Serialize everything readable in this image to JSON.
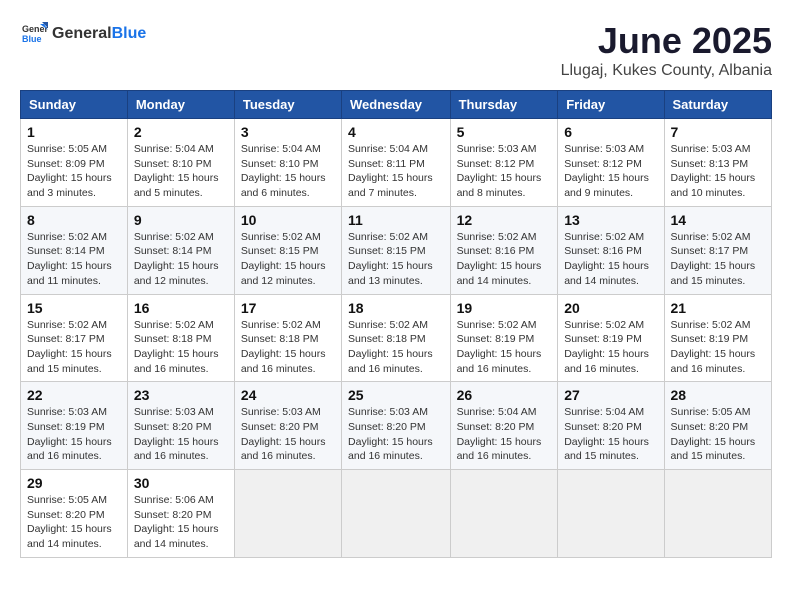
{
  "logo": {
    "general": "General",
    "blue": "Blue"
  },
  "header": {
    "month_year": "June 2025",
    "location": "Llugaj, Kukes County, Albania"
  },
  "weekdays": [
    "Sunday",
    "Monday",
    "Tuesday",
    "Wednesday",
    "Thursday",
    "Friday",
    "Saturday"
  ],
  "weeks": [
    [
      {
        "day": "1",
        "info": "Sunrise: 5:05 AM\nSunset: 8:09 PM\nDaylight: 15 hours\nand 3 minutes."
      },
      {
        "day": "2",
        "info": "Sunrise: 5:04 AM\nSunset: 8:10 PM\nDaylight: 15 hours\nand 5 minutes."
      },
      {
        "day": "3",
        "info": "Sunrise: 5:04 AM\nSunset: 8:10 PM\nDaylight: 15 hours\nand 6 minutes."
      },
      {
        "day": "4",
        "info": "Sunrise: 5:04 AM\nSunset: 8:11 PM\nDaylight: 15 hours\nand 7 minutes."
      },
      {
        "day": "5",
        "info": "Sunrise: 5:03 AM\nSunset: 8:12 PM\nDaylight: 15 hours\nand 8 minutes."
      },
      {
        "day": "6",
        "info": "Sunrise: 5:03 AM\nSunset: 8:12 PM\nDaylight: 15 hours\nand 9 minutes."
      },
      {
        "day": "7",
        "info": "Sunrise: 5:03 AM\nSunset: 8:13 PM\nDaylight: 15 hours\nand 10 minutes."
      }
    ],
    [
      {
        "day": "8",
        "info": "Sunrise: 5:02 AM\nSunset: 8:14 PM\nDaylight: 15 hours\nand 11 minutes."
      },
      {
        "day": "9",
        "info": "Sunrise: 5:02 AM\nSunset: 8:14 PM\nDaylight: 15 hours\nand 12 minutes."
      },
      {
        "day": "10",
        "info": "Sunrise: 5:02 AM\nSunset: 8:15 PM\nDaylight: 15 hours\nand 12 minutes."
      },
      {
        "day": "11",
        "info": "Sunrise: 5:02 AM\nSunset: 8:15 PM\nDaylight: 15 hours\nand 13 minutes."
      },
      {
        "day": "12",
        "info": "Sunrise: 5:02 AM\nSunset: 8:16 PM\nDaylight: 15 hours\nand 14 minutes."
      },
      {
        "day": "13",
        "info": "Sunrise: 5:02 AM\nSunset: 8:16 PM\nDaylight: 15 hours\nand 14 minutes."
      },
      {
        "day": "14",
        "info": "Sunrise: 5:02 AM\nSunset: 8:17 PM\nDaylight: 15 hours\nand 15 minutes."
      }
    ],
    [
      {
        "day": "15",
        "info": "Sunrise: 5:02 AM\nSunset: 8:17 PM\nDaylight: 15 hours\nand 15 minutes."
      },
      {
        "day": "16",
        "info": "Sunrise: 5:02 AM\nSunset: 8:18 PM\nDaylight: 15 hours\nand 16 minutes."
      },
      {
        "day": "17",
        "info": "Sunrise: 5:02 AM\nSunset: 8:18 PM\nDaylight: 15 hours\nand 16 minutes."
      },
      {
        "day": "18",
        "info": "Sunrise: 5:02 AM\nSunset: 8:18 PM\nDaylight: 15 hours\nand 16 minutes."
      },
      {
        "day": "19",
        "info": "Sunrise: 5:02 AM\nSunset: 8:19 PM\nDaylight: 15 hours\nand 16 minutes."
      },
      {
        "day": "20",
        "info": "Sunrise: 5:02 AM\nSunset: 8:19 PM\nDaylight: 15 hours\nand 16 minutes."
      },
      {
        "day": "21",
        "info": "Sunrise: 5:02 AM\nSunset: 8:19 PM\nDaylight: 15 hours\nand 16 minutes."
      }
    ],
    [
      {
        "day": "22",
        "info": "Sunrise: 5:03 AM\nSunset: 8:19 PM\nDaylight: 15 hours\nand 16 minutes."
      },
      {
        "day": "23",
        "info": "Sunrise: 5:03 AM\nSunset: 8:20 PM\nDaylight: 15 hours\nand 16 minutes."
      },
      {
        "day": "24",
        "info": "Sunrise: 5:03 AM\nSunset: 8:20 PM\nDaylight: 15 hours\nand 16 minutes."
      },
      {
        "day": "25",
        "info": "Sunrise: 5:03 AM\nSunset: 8:20 PM\nDaylight: 15 hours\nand 16 minutes."
      },
      {
        "day": "26",
        "info": "Sunrise: 5:04 AM\nSunset: 8:20 PM\nDaylight: 15 hours\nand 16 minutes."
      },
      {
        "day": "27",
        "info": "Sunrise: 5:04 AM\nSunset: 8:20 PM\nDaylight: 15 hours\nand 15 minutes."
      },
      {
        "day": "28",
        "info": "Sunrise: 5:05 AM\nSunset: 8:20 PM\nDaylight: 15 hours\nand 15 minutes."
      }
    ],
    [
      {
        "day": "29",
        "info": "Sunrise: 5:05 AM\nSunset: 8:20 PM\nDaylight: 15 hours\nand 14 minutes."
      },
      {
        "day": "30",
        "info": "Sunrise: 5:06 AM\nSunset: 8:20 PM\nDaylight: 15 hours\nand 14 minutes."
      },
      {
        "day": "",
        "info": ""
      },
      {
        "day": "",
        "info": ""
      },
      {
        "day": "",
        "info": ""
      },
      {
        "day": "",
        "info": ""
      },
      {
        "day": "",
        "info": ""
      }
    ]
  ]
}
